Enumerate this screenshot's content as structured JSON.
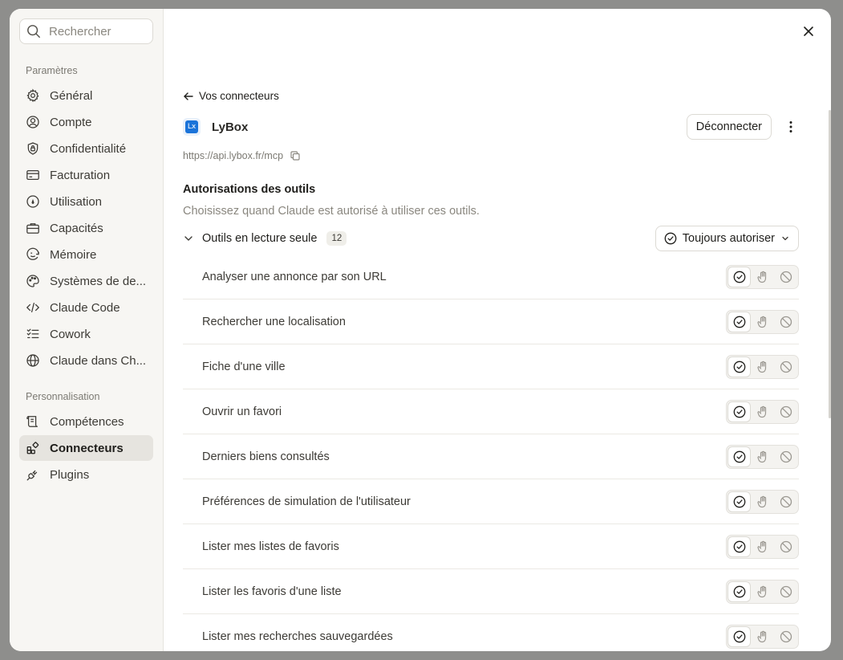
{
  "search": {
    "placeholder": "Rechercher"
  },
  "sidebar": {
    "section_settings": "Paramètres",
    "items": [
      {
        "label": "Général",
        "icon": "gear-icon"
      },
      {
        "label": "Compte",
        "icon": "user-circle-icon"
      },
      {
        "label": "Confidentialité",
        "icon": "shield-icon"
      },
      {
        "label": "Facturation",
        "icon": "credit-card-icon"
      },
      {
        "label": "Utilisation",
        "icon": "gauge-icon"
      },
      {
        "label": "Capacités",
        "icon": "briefcase-icon"
      },
      {
        "label": "Mémoire",
        "icon": "memory-icon"
      },
      {
        "label": "Systèmes de de...",
        "icon": "palette-icon"
      },
      {
        "label": "Claude Code",
        "icon": "code-icon"
      },
      {
        "label": "Cowork",
        "icon": "checklist-icon"
      },
      {
        "label": "Claude dans Ch...",
        "icon": "globe-icon"
      }
    ],
    "section_personal": "Personnalisation",
    "items2": [
      {
        "label": "Compétences",
        "icon": "scroll-icon"
      },
      {
        "label": "Connecteurs",
        "icon": "connectors-icon",
        "active": true
      },
      {
        "label": "Plugins",
        "icon": "plug-icon"
      }
    ]
  },
  "main": {
    "back_label": "Vos connecteurs",
    "connector_name": "LyBox",
    "logo_text": "Lx",
    "disconnect_label": "Déconnecter",
    "url": "https://api.lybox.fr/mcp",
    "permissions_title": "Autorisations des outils",
    "permissions_desc": "Choisissez quand Claude est autorisé à utiliser ces outils.",
    "group_label": "Outils en lecture seule",
    "group_count": "12",
    "group_policy": "Toujours autoriser",
    "tools": [
      "Analyser une annonce par son URL",
      "Rechercher une localisation",
      "Fiche d'une ville",
      "Ouvrir un favori",
      "Derniers biens consultés",
      "Préférences de simulation de l'utilisateur",
      "Lister mes listes de favoris",
      "Lister les favoris d'une liste",
      "Lister mes recherches sauvegardées"
    ]
  }
}
